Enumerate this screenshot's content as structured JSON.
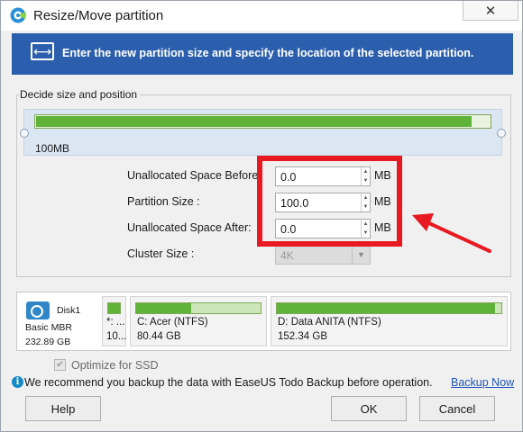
{
  "window": {
    "title": "Resize/Move partition",
    "close_label": "✕"
  },
  "banner": {
    "text": "Enter the new partition size and specify the location of the selected partition."
  },
  "group": {
    "legend": "Decide size and position",
    "size_label": "100MB",
    "bar_fill_fraction": 0.96
  },
  "form": {
    "before": {
      "label": "Unallocated Space Before:",
      "value": "0.0",
      "unit": "MB"
    },
    "size": {
      "label": "Partition Size :",
      "value": "100.0",
      "unit": "MB"
    },
    "after": {
      "label": "Unallocated Space After:",
      "value": "0.0",
      "unit": "MB"
    },
    "cluster": {
      "label": "Cluster Size :",
      "value": "4K"
    }
  },
  "disk": {
    "name": "Disk1",
    "type": "Basic MBR",
    "capacity": "232.89 GB",
    "partitions": [
      {
        "name": "*: ...",
        "size": "10...",
        "fill_fraction": 1.0
      },
      {
        "name": "C: Acer (NTFS)",
        "size": "80.44 GB",
        "fill_fraction": 0.44
      },
      {
        "name": "D: Data ANITA (NTFS)",
        "size": "152.34 GB",
        "fill_fraction": 0.97
      }
    ]
  },
  "ssd": {
    "label": "Optimize for SSD",
    "checked": true
  },
  "notice": {
    "text": "We recommend you backup the data with EaseUS Todo Backup before operation.",
    "link": "Backup Now"
  },
  "buttons": {
    "help": "Help",
    "ok": "OK",
    "cancel": "Cancel"
  },
  "colors": {
    "banner": "#2b5fad",
    "bar_green": "#5fb338",
    "highlight": "#e81920",
    "link": "#1f56b8"
  }
}
